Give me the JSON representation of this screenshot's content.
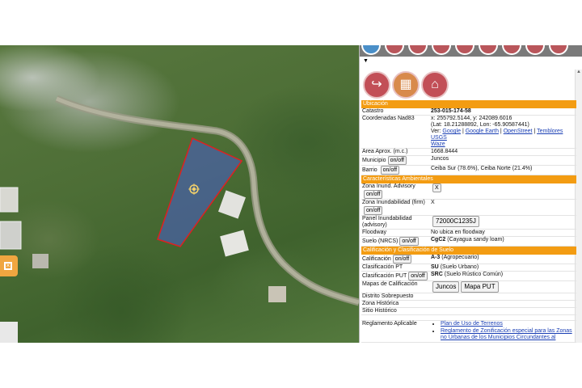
{
  "colors": {
    "accent": "#f39c12",
    "parcel_fill": "#4a5fc0",
    "parcel_stroke": "#e02020",
    "icon": "#c24f57"
  },
  "icons": {
    "toolbar": [
      "layers-icon",
      "stack-icon",
      "stack-icon",
      "stack-icon",
      "document-icon",
      "map-icon",
      "edit-icon",
      "print-icon",
      "location-icon"
    ],
    "big": [
      "draw-icon",
      "crim-logo-icon",
      "home-icon"
    ],
    "map_center": "target-icon",
    "side_toggle": "close-icon"
  },
  "sections": {
    "ubicacion": "Ubicación",
    "ambientales": "Características Ambientales",
    "calificacion": "Calificación y Clasificación de Suelo"
  },
  "rows": {
    "catastro": {
      "label": "Catastro",
      "value": "253-015-174-58"
    },
    "coordenadas": {
      "label": "Coordenadas Nad83",
      "line1": "x: 255792.5144, y: 242089.6016",
      "line2": "(Lat: 18.21288892, Lon: -65.90587441)",
      "ver": "Ver:",
      "links": [
        "Google",
        "Google Earth",
        "OpenStreet",
        "Temblores USGS",
        "Waze"
      ],
      "sep": "|"
    },
    "area": {
      "label": "Area Aprox. (m.c.)",
      "value": "1668.8444"
    },
    "municipio": {
      "label": "Municipio",
      "button": "on/off",
      "value": "Juncos"
    },
    "barrio": {
      "label": "Barrio",
      "button": "on/off",
      "value": "Ceiba Sur (78.6%), Ceiba Norte (21.4%)"
    },
    "inund_adv": {
      "label": "Zona Inund. Advisory",
      "button": "on/off",
      "value": "X"
    },
    "inund_firm": {
      "label": "Zona Inundabilidad (firm)",
      "button": "on/off",
      "value": "X"
    },
    "panel": {
      "label": "Panel Inundabilidad (advisory)",
      "value": "72000C1235J"
    },
    "floodway": {
      "label": "Floodway",
      "value": "No ubica en floodway"
    },
    "suelo": {
      "label": "Suelo (NRCS)",
      "button": "on/off",
      "code": "CgC2",
      "desc": "(Cayagua sandy loam)"
    },
    "calif": {
      "label": "Calificación",
      "button": "on/off",
      "code": "A-3",
      "desc": "(Agropecuario)"
    },
    "clas_pt": {
      "label": "Clasificación PT",
      "code": "SU",
      "desc": "(Suelo Urbano)"
    },
    "clas_put": {
      "label": "Clasificación PUT",
      "button": "on/off",
      "code": "SRC",
      "desc": "(Suelo Rústico Común)"
    },
    "mapas": {
      "label": "Mapas de Calificación",
      "btn1": "Juncos",
      "btn2": "Mapa PUT"
    },
    "distrito": {
      "label": "Distrito Sobrepuesto"
    },
    "zona_hist": {
      "label": "Zona Histórica"
    },
    "sitio_hist": {
      "label": "Sitio Histórico"
    },
    "reglamento": {
      "label": "Reglamento Aplicable",
      "items": [
        "Plan de Uso de Terrenos",
        "Reglamento de Zonificación especial para las Zonas no Urbanas de los Municipios Circundantes al"
      ]
    }
  }
}
